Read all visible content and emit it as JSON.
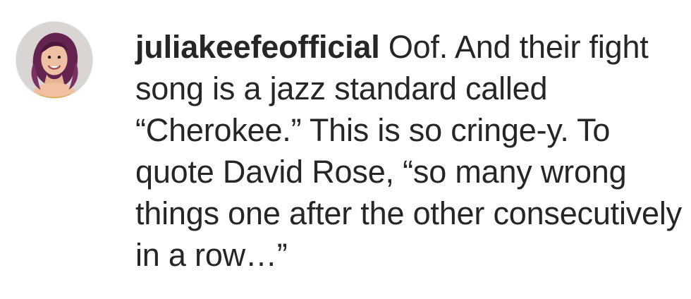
{
  "comment": {
    "username": "juliakeefeofficial",
    "text": "Oof. And their fight song is a jazz standard called “Cherokee.” This is so cringe-y. To quote David Rose, “so many wrong things one after the other consecutively in a row…”"
  },
  "avatar": {
    "icon": "user-avatar-photo"
  },
  "colors": {
    "text": "#262626",
    "background": "#ffffff"
  }
}
